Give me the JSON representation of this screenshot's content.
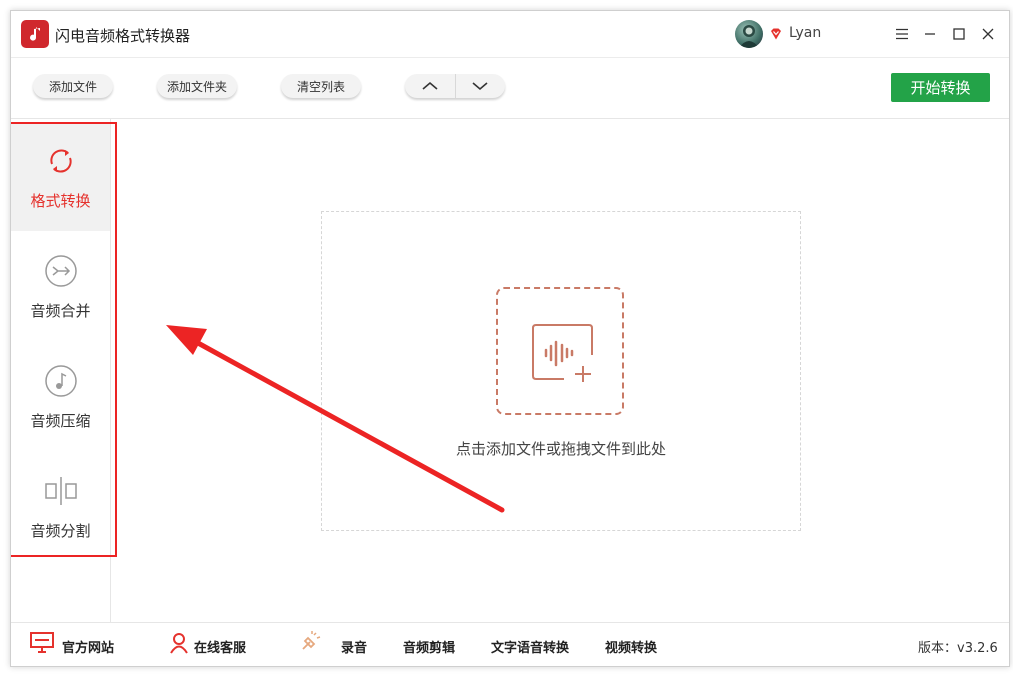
{
  "app": {
    "title": "闪电音频格式转换器"
  },
  "user": {
    "name": "Lyan"
  },
  "toolbar": {
    "add_file": "添加文件",
    "add_folder": "添加文件夹",
    "clear_list": "清空列表",
    "start": "开始转换"
  },
  "sidebar": {
    "items": [
      {
        "label": "格式转换",
        "icon": "convert-icon",
        "active": true
      },
      {
        "label": "音频合并",
        "icon": "merge-icon",
        "active": false
      },
      {
        "label": "音频压缩",
        "icon": "compress-icon",
        "active": false
      },
      {
        "label": "音频分割",
        "icon": "split-icon",
        "active": false
      }
    ]
  },
  "dropzone": {
    "hint": "点击添加文件或拖拽文件到此处"
  },
  "footer": {
    "official_site": "官方网站",
    "online_service": "在线客服",
    "record": "录音",
    "audio_cut": "音频剪辑",
    "text_to_speech": "文字语音转换",
    "video_convert": "视频转换",
    "version": "版本：v3.2.6"
  },
  "colors": {
    "accent_red": "#e5322d",
    "start_green": "#23a348",
    "drop_border": "#c97a66"
  }
}
